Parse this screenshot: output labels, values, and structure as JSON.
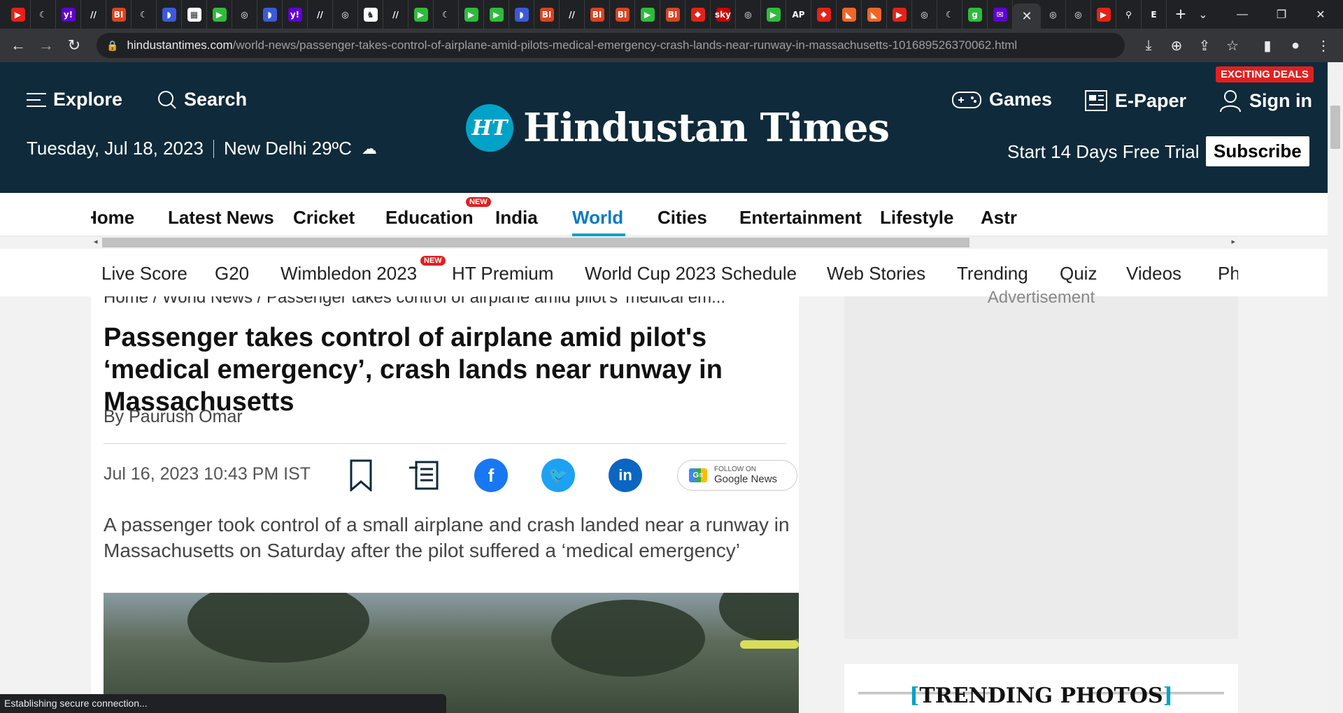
{
  "browser": {
    "tabs": [
      {
        "icon": "youtube-icon",
        "glyph": "▶",
        "bg": "#e62117"
      },
      {
        "icon": "shield-icon",
        "glyph": "☾",
        "bg": "#202124"
      },
      {
        "icon": "yahoo-icon",
        "glyph": "y!",
        "bg": "#6001d2"
      },
      {
        "icon": "site-icon",
        "glyph": "//",
        "bg": "#202124"
      },
      {
        "icon": "bi-icon",
        "glyph": "BI",
        "bg": "#d64422"
      },
      {
        "icon": "shield-icon",
        "glyph": "☾",
        "bg": "#202124"
      },
      {
        "icon": "bookmark-icon",
        "glyph": "◗",
        "bg": "#3a5ad9"
      },
      {
        "icon": "puzzle-icon",
        "glyph": "▦",
        "bg": "#ffffff"
      },
      {
        "icon": "play-icon",
        "glyph": "▶",
        "bg": "#2dbc3b"
      },
      {
        "icon": "globe-icon",
        "glyph": "◎",
        "bg": "#202124"
      },
      {
        "icon": "bookmark-icon",
        "glyph": "◗",
        "bg": "#3a5ad9"
      },
      {
        "icon": "yahoo-icon",
        "glyph": "y!",
        "bg": "#6001d2"
      },
      {
        "icon": "site-icon",
        "glyph": "//",
        "bg": "#202124"
      },
      {
        "icon": "globe-icon",
        "glyph": "◎",
        "bg": "#202124"
      },
      {
        "icon": "news-icon",
        "glyph": "♞",
        "bg": "#ffffff"
      },
      {
        "icon": "site-icon",
        "glyph": "//",
        "bg": "#202124"
      },
      {
        "icon": "play-icon",
        "glyph": "▶",
        "bg": "#2dbc3b"
      },
      {
        "icon": "shield-icon",
        "glyph": "☾",
        "bg": "#202124"
      },
      {
        "icon": "play-icon",
        "glyph": "▶",
        "bg": "#2dbc3b"
      },
      {
        "icon": "play-icon",
        "glyph": "▶",
        "bg": "#2dbc3b"
      },
      {
        "icon": "bookmark-icon",
        "glyph": "◗",
        "bg": "#3a5ad9"
      },
      {
        "icon": "bi-icon",
        "glyph": "BI",
        "bg": "#d64422"
      },
      {
        "icon": "site-icon",
        "glyph": "//",
        "bg": "#202124"
      },
      {
        "icon": "bi-icon",
        "glyph": "BI",
        "bg": "#d64422"
      },
      {
        "icon": "bi-icon",
        "glyph": "BI",
        "bg": "#d64422"
      },
      {
        "icon": "play-icon",
        "glyph": "▶",
        "bg": "#2dbc3b"
      },
      {
        "icon": "bi-icon",
        "glyph": "BI",
        "bg": "#d64422"
      },
      {
        "icon": "mic-icon",
        "glyph": "⬥",
        "bg": "#e62117"
      },
      {
        "icon": "sky-news-icon",
        "glyph": "sky",
        "bg": "#c00"
      },
      {
        "icon": "globe-icon",
        "glyph": "◎",
        "bg": "#202124"
      },
      {
        "icon": "play-icon",
        "glyph": "▶",
        "bg": "#2dbc3b"
      },
      {
        "icon": "news-icon",
        "glyph": "AP",
        "bg": "#202124"
      },
      {
        "icon": "mic-icon",
        "glyph": "⬥",
        "bg": "#e62117"
      },
      {
        "icon": "bookmark-icon",
        "glyph": "◣",
        "bg": "#f26522"
      },
      {
        "icon": "bookmark-icon",
        "glyph": "◣",
        "bg": "#f26522"
      },
      {
        "icon": "youtube-icon",
        "glyph": "▶",
        "bg": "#e62117"
      },
      {
        "icon": "globe-icon",
        "glyph": "◎",
        "bg": "#202124"
      },
      {
        "icon": "shield-icon",
        "glyph": "☾",
        "bg": "#202124"
      },
      {
        "icon": "g-icon",
        "glyph": "g",
        "bg": "#2dbc3b"
      },
      {
        "icon": "mail-icon",
        "glyph": "✉",
        "bg": "#6001d2"
      }
    ],
    "tabs_after": [
      {
        "icon": "globe-icon",
        "glyph": "◎",
        "bg": "#202124"
      },
      {
        "icon": "globe-icon",
        "glyph": "◎",
        "bg": "#202124"
      },
      {
        "icon": "youtube-icon",
        "glyph": "▶",
        "bg": "#e62117"
      },
      {
        "icon": "search-icon",
        "glyph": "⚲",
        "bg": "#202124"
      },
      {
        "icon": "etsy-icon",
        "glyph": "E",
        "bg": "#202124"
      }
    ],
    "url_host": "hindustantimes.com",
    "url_path": "/world-news/passenger-takes-control-of-airplane-amid-pilots-medical-emergency-crash-lands-near-runway-in-massachusetts-101689526370062.html",
    "status_text": "Establishing secure connection..."
  },
  "header": {
    "explore": "Explore",
    "search": "Search",
    "date": "Tuesday, Jul 18, 2023",
    "weather": "New Delhi 29ºC",
    "logo_mark": "HT",
    "logo_text": "Hindustan Times",
    "games": "Games",
    "epaper": "E-Paper",
    "signin": "Sign in",
    "deals": "EXCITING DEALS",
    "trial": "Start 14 Days Free Trial",
    "subscribe": "Subscribe",
    "colors": {
      "bg": "#0f2a3a",
      "accent": "#00a3c7",
      "badge": "#e02020"
    }
  },
  "nav_primary": [
    {
      "label": "Home"
    },
    {
      "label": "Latest News"
    },
    {
      "label": "Cricket"
    },
    {
      "label": "Education",
      "badge": "NEW"
    },
    {
      "label": "India"
    },
    {
      "label": "World",
      "active": true
    },
    {
      "label": "Cities"
    },
    {
      "label": "Entertainment"
    },
    {
      "label": "Lifestyle"
    },
    {
      "label": "Astr"
    }
  ],
  "nav_secondary": [
    {
      "label": "Live Score"
    },
    {
      "label": "G20"
    },
    {
      "label": "Wimbledon 2023",
      "badge": "NEW"
    },
    {
      "label": "HT Premium"
    },
    {
      "label": "World Cup 2023 Schedule"
    },
    {
      "label": "Web Stories"
    },
    {
      "label": "Trending"
    },
    {
      "label": "Quiz"
    },
    {
      "label": "Videos"
    },
    {
      "label": "Ph"
    }
  ],
  "article": {
    "breadcrumb": "Home  /  World News  /  Passenger takes control of airplane amid pilot's 'medical em...",
    "headline": "Passenger takes control of airplane amid pilot's ‘medical emergency’, crash lands near runway in Massachusetts",
    "byline": "By Paurush Omar",
    "published": "Jul 16, 2023 10:43 PM IST",
    "google_news_top": "FOLLOW ON",
    "google_news_bottom": "Google News",
    "google_news_mark": "G≡",
    "summary": "A passenger took control of a small airplane and crash landed near a runway in Massachusetts on Saturday after the pilot suffered a ‘medical emergency’"
  },
  "sidebar": {
    "ad_label": "Advertisement",
    "trending_title": "TRENDING PHOTOS"
  }
}
